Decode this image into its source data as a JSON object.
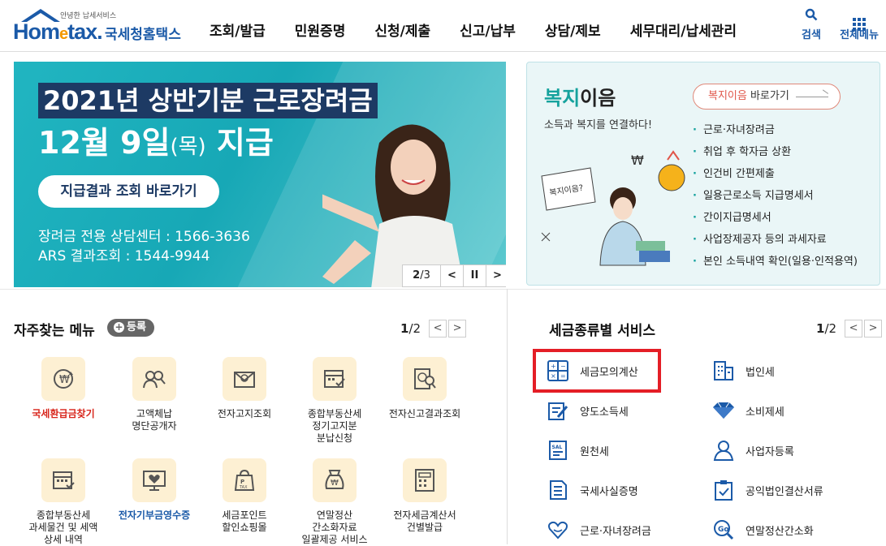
{
  "header": {
    "logo_tagline": "안녕한 납세서비스",
    "logo_word_home": "Hom",
    "logo_word_e": "e",
    "logo_word_tax": "tax.",
    "logo_korean": "국세청홈택스",
    "nav": [
      "조회/발급",
      "민원증명",
      "신청/제출",
      "신고/납부",
      "상담/제보",
      "세무대리/납세관리"
    ],
    "search_label": "검색",
    "allmenu_label": "전체메뉴"
  },
  "banner": {
    "title_line1": "2021년 상반기분 근로장려금",
    "title_line2a": "12월 9일",
    "title_line2b": "(목)",
    "title_line2c": " 지급",
    "button": "지급결과 조회 바로가기",
    "line1": "장려금 전용 상담센터 : 1566-3636",
    "line2": "ARS 결과조회 : 1544-9944",
    "pager_current": "2",
    "pager_total": "/3",
    "prev": "<",
    "pause": "II",
    "next": ">"
  },
  "welfare": {
    "title_accent": "복지",
    "title_rest": "이음",
    "subtitle": "소득과 복지를 연결하다!",
    "button_accent": "복지이음",
    "button_rest": " 바로가기",
    "items": [
      "근로·자녀장려금",
      "취업 후 학자금 상환",
      "인건비 간편제출",
      "일용근로소득 지급명세서",
      "간이지급명세서",
      "사업장제공자 등의 과세자료",
      "본인 소득내역 확인(일용·인적용역)"
    ],
    "sign_text": "복지이음?"
  },
  "favorites": {
    "title": "자주찾는 메뉴",
    "register": "등록",
    "page_current": "1",
    "page_total": "/2",
    "items": [
      {
        "label": "국세환급금찾기",
        "style": "red"
      },
      {
        "label": "고액체납\n명단공개자",
        "style": ""
      },
      {
        "label": "전자고지조회",
        "style": ""
      },
      {
        "label": "종합부동산세\n정기고지분\n분납신청",
        "style": ""
      },
      {
        "label": "전자신고결과조회",
        "style": ""
      },
      {
        "label": "종합부동산세\n과세물건 및 세액\n상세 내역",
        "style": ""
      },
      {
        "label": "전자기부금영수증",
        "style": "blue"
      },
      {
        "label": "세금포인트\n할인쇼핑몰",
        "style": ""
      },
      {
        "label": "연말정산\n간소화자료\n일괄제공 서비스",
        "style": ""
      },
      {
        "label": "전자세금계산서\n건별발급",
        "style": ""
      }
    ]
  },
  "tax_services": {
    "title": "세금종류별 서비스",
    "page_current": "1",
    "page_total": "/2",
    "items": [
      "세금모의계산",
      "법인세",
      "양도소득세",
      "소비제세",
      "원천세",
      "사업자등록",
      "국세사실증명",
      "공익법인결산서류",
      "근로·자녀장려금",
      "연말정산간소화"
    ]
  },
  "colors": {
    "brand": "#1b5aa8",
    "accent_orange": "#f39800",
    "banner_teal": "#21b5c1",
    "welfare_teal": "#15a29d",
    "highlight_red": "#e41e26"
  }
}
